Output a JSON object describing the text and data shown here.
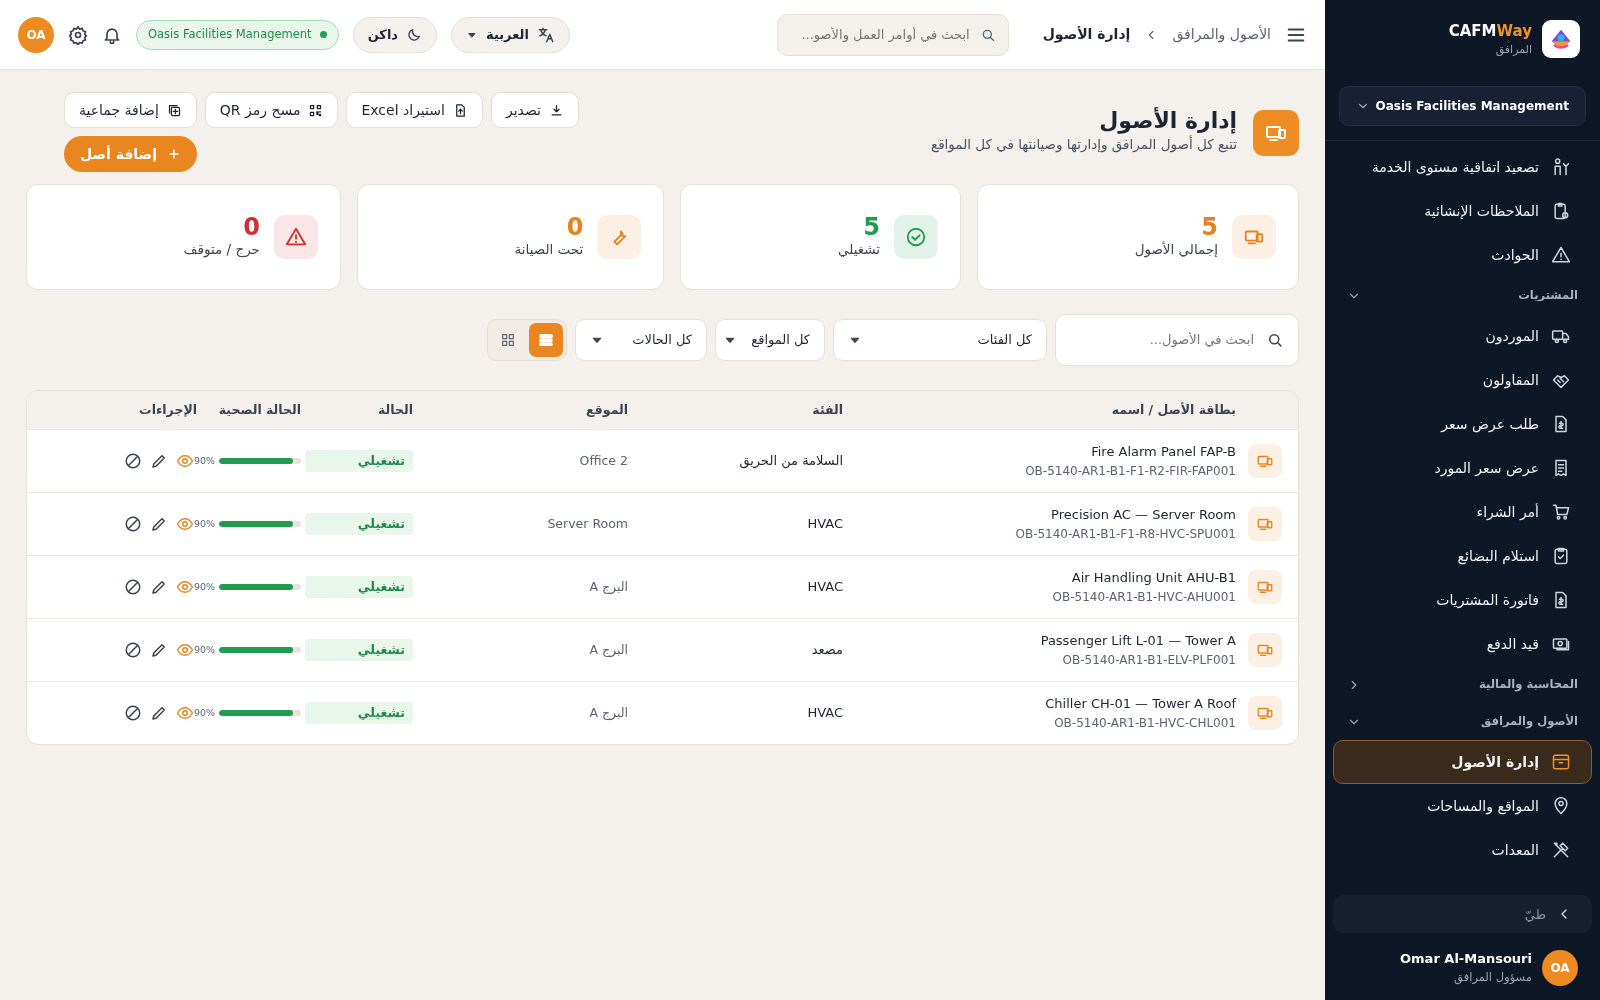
{
  "sidebar": {
    "brand_main": "CAFM",
    "brand_accent": "Way",
    "brand_sub": "المرافق",
    "org": "Oasis Facilities Management",
    "items": [
      {
        "kind": "item",
        "label": "تصعيد اتفاقية مستوى الخدمة",
        "selected": false
      },
      {
        "kind": "item",
        "label": "الملاحظات الإنشائية",
        "selected": false
      },
      {
        "kind": "item",
        "label": "الحوادث",
        "selected": false
      },
      {
        "kind": "section",
        "label": "المشتريات",
        "expanded": true
      },
      {
        "kind": "item",
        "label": "الموردون",
        "selected": false
      },
      {
        "kind": "item",
        "label": "المقاولون",
        "selected": false
      },
      {
        "kind": "item",
        "label": "طلب عرض سعر",
        "selected": false
      },
      {
        "kind": "item",
        "label": "عرض سعر المورد",
        "selected": false
      },
      {
        "kind": "item",
        "label": "أمر الشراء",
        "selected": false
      },
      {
        "kind": "item",
        "label": "استلام البضائع",
        "selected": false
      },
      {
        "kind": "item",
        "label": "فاتورة المشتريات",
        "selected": false
      },
      {
        "kind": "item",
        "label": "قيد الدفع",
        "selected": false
      },
      {
        "kind": "section",
        "label": "المحاسبة والمالية",
        "expanded": false
      },
      {
        "kind": "section",
        "label": "الأصول والمرافق",
        "expanded": true
      },
      {
        "kind": "item",
        "label": "إدارة الأصول",
        "selected": true
      },
      {
        "kind": "item",
        "label": "المواقع والمساحات",
        "selected": false
      },
      {
        "kind": "item",
        "label": "المعدات",
        "selected": false
      }
    ],
    "collapse": "طيّ",
    "user": {
      "initials": "OA",
      "name": "Omar Al-Mansouri",
      "role": "مسؤول المرافق"
    }
  },
  "topbar": {
    "breadcrumb": [
      "الأصول والمرافق",
      "إدارة الأصول"
    ],
    "search": {
      "placeholder": "ابحث في أوامر العمل والأصو..."
    },
    "language": "العربية",
    "theme": "داكن",
    "org_badge": "Oasis Facilities Management",
    "avatar": "OA"
  },
  "header": {
    "title": "إدارة الأصول",
    "subtitle": "تتبع كل أصول المرافق وإدارتها وصيانتها في كل المواقع",
    "actions": [
      {
        "kind": "export",
        "label": "تصدير"
      },
      {
        "kind": "import",
        "label": "استيراد Excel"
      },
      {
        "kind": "qr",
        "label": "مسح رمز QR"
      },
      {
        "kind": "bulk",
        "label": "إضافة جماعية"
      }
    ],
    "primary": "إضافة أصل"
  },
  "stats": [
    {
      "kind": "assets",
      "value": "5",
      "label": "إجمالي الأصول",
      "color": "#e8821e"
    },
    {
      "kind": "running",
      "value": "5",
      "label": "تشغيلي",
      "color": "#1f9d4c"
    },
    {
      "kind": "maintenance",
      "value": "0",
      "label": "تحت الصيانة",
      "color": "#e8821e"
    },
    {
      "kind": "critical",
      "value": "0",
      "label": "حرج / متوقف",
      "color": "#d32f2f"
    }
  ],
  "filters": {
    "search": {
      "placeholder": "ابحث في الأصول..."
    },
    "selects": [
      "كل الفئات",
      "كل المواقع",
      "كل الحالات"
    ],
    "views": [
      {
        "kind": "list",
        "selected": true
      },
      {
        "kind": "grid",
        "selected": false
      }
    ]
  },
  "table": {
    "columns": [
      "بطاقة الأصل / اسمه",
      "الفئة",
      "الموقع",
      "الحالة",
      "الحالة الصحية",
      "الإجراءات"
    ],
    "rows": [
      {
        "name": "Fire Alarm Panel FAP-B",
        "code": "OB-5140-AR1-B1-F1-R2-FIR-FAP001",
        "category": "السلامة من الحريق",
        "location": "Office 2",
        "status": "تشغيلي",
        "health": {
          "level": 0.9,
          "reading": "90%"
        }
      },
      {
        "name": "Precision AC — Server Room",
        "code": "OB-5140-AR1-B1-F1-R8-HVC-SPU001",
        "category": "HVAC",
        "location": "Server Room",
        "status": "تشغيلي",
        "health": {
          "level": 0.9,
          "reading": "90%"
        }
      },
      {
        "name": "Air Handling Unit AHU-B1",
        "code": "OB-5140-AR1-B1-HVC-AHU001",
        "category": "HVAC",
        "location": "البرج A",
        "status": "تشغيلي",
        "health": {
          "level": 0.9,
          "reading": "90%"
        }
      },
      {
        "name": "Passenger Lift L-01 — Tower A",
        "code": "OB-5140-AR1-B1-ELV-PLF001",
        "category": "مصعد",
        "location": "البرج A",
        "status": "تشغيلي",
        "health": {
          "level": 0.9,
          "reading": "90%"
        }
      },
      {
        "name": "Chiller CH-01 — Tower A Roof",
        "code": "OB-5140-AR1-B1-HVC-CHL001",
        "category": "HVAC",
        "location": "البرج A",
        "status": "تشغيلي",
        "health": {
          "level": 0.9,
          "reading": "90%"
        }
      }
    ]
  }
}
